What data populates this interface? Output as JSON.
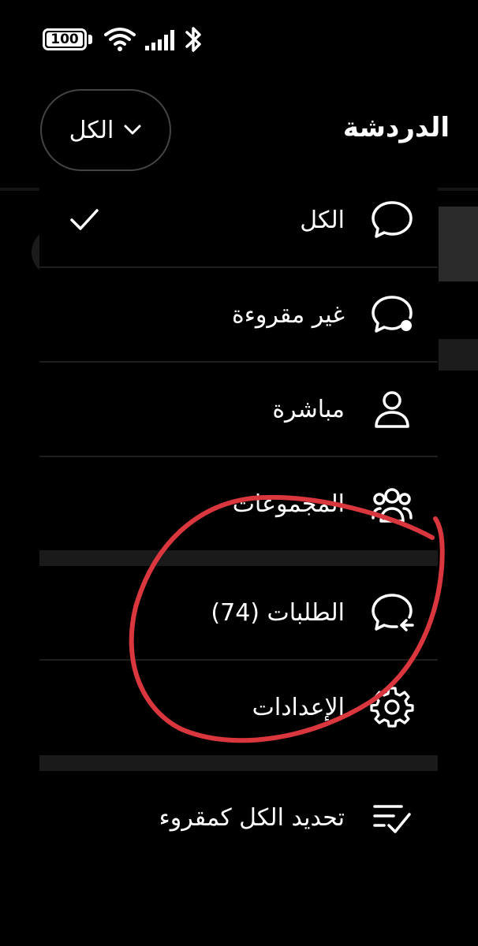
{
  "status_bar": {
    "battery": "100",
    "icons": [
      "battery-icon",
      "wifi-icon",
      "signal-icon",
      "bluetooth-icon"
    ]
  },
  "header": {
    "title": "الدردشة",
    "filter": {
      "label": "الكل",
      "icon": "chevron-down-icon"
    }
  },
  "menu": {
    "items": [
      {
        "label": "الكل",
        "icon": "chat-bubble-icon",
        "selected": true
      },
      {
        "label": "غير مقروءة",
        "icon": "chat-unread-icon",
        "selected": false
      },
      {
        "label": "مباشرة",
        "icon": "person-icon",
        "selected": false
      },
      {
        "label": "المجموعات",
        "icon": "group-icon",
        "selected": false
      },
      {
        "label": "الطلبات (74)",
        "icon": "chat-request-icon",
        "selected": false
      },
      {
        "label": "الإعدادات",
        "icon": "gear-icon",
        "selected": false
      },
      {
        "label": "تحديد الكل كمقروء",
        "icon": "mark-all-read-icon",
        "selected": false
      }
    ]
  },
  "colors": {
    "background": "#000000",
    "text": "#ffffff",
    "annotation": "#d9363e",
    "divider": "#1e1e1e"
  }
}
